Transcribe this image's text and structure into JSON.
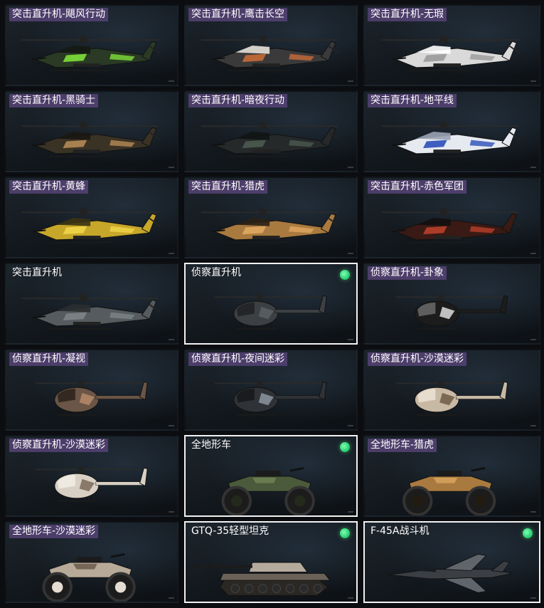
{
  "items": [
    {
      "name": "突击直升机-飓风行动",
      "type": "attack-heli",
      "camo": [
        "#2a3a24",
        "#7ee03a",
        "#151a12"
      ],
      "badge": "tagged",
      "selected": false
    },
    {
      "name": "突击直升机-鹰击长空",
      "type": "attack-heli",
      "camo": [
        "#3a3a3a",
        "#c86c3a",
        "#e8e2da"
      ],
      "badge": "tagged",
      "selected": false
    },
    {
      "name": "突击直升机-无瑕",
      "type": "attack-heli",
      "camo": [
        "#d9d9d9",
        "#9a9a9a",
        "#ffffff"
      ],
      "badge": "tagged",
      "selected": false
    },
    {
      "name": "突击直升机-黑骑士",
      "type": "attack-heli",
      "camo": [
        "#3a3225",
        "#b58a55",
        "#1b1712"
      ],
      "badge": "tagged",
      "selected": false
    },
    {
      "name": "突击直升机-暗夜行动",
      "type": "attack-heli",
      "camo": [
        "#25292a",
        "#4c5a4f",
        "#111414"
      ],
      "badge": "tagged",
      "selected": false
    },
    {
      "name": "突击直升机-地平线",
      "type": "attack-heli",
      "camo": [
        "#e6eaf0",
        "#2a4fb8",
        "#9aa3b4"
      ],
      "badge": "tagged",
      "selected": false
    },
    {
      "name": "突击直升机-黄蜂",
      "type": "attack-heli",
      "camo": [
        "#c7a72a",
        "#f0d64a",
        "#3b3414"
      ],
      "badge": "tagged",
      "selected": false
    },
    {
      "name": "突击直升机-猎虎",
      "type": "attack-heli",
      "camo": [
        "#a97a3f",
        "#e0a862",
        "#2b2116"
      ],
      "badge": "tagged",
      "selected": false
    },
    {
      "name": "突击直升机-赤色军团",
      "type": "attack-heli",
      "camo": [
        "#3a1a14",
        "#b8402a",
        "#141010"
      ],
      "badge": "tagged",
      "selected": false
    },
    {
      "name": "突击直升机",
      "type": "attack-heli",
      "camo": [
        "#555b5e",
        "#7d8488",
        "#2b2f31"
      ],
      "badge": "plain",
      "selected": false
    },
    {
      "name": "侦察直升机",
      "type": "scout-heli",
      "camo": [
        "#3c4043",
        "#5a6064",
        "#1e2123"
      ],
      "badge": "plain",
      "selected": true
    },
    {
      "name": "侦察直升机-卦象",
      "type": "scout-heli",
      "camo": [
        "#1c1c1c",
        "#dcdcdc",
        "#6a6a6a"
      ],
      "badge": "tagged",
      "selected": false
    },
    {
      "name": "侦察直升机-凝视",
      "type": "scout-heli",
      "camo": [
        "#6a5546",
        "#b68a6a",
        "#2a221b"
      ],
      "badge": "tagged",
      "selected": false
    },
    {
      "name": "侦察直升机-夜间迷彩",
      "type": "scout-heli",
      "camo": [
        "#2f3236",
        "#8c95a0",
        "#15171a"
      ],
      "badge": "tagged",
      "selected": false
    },
    {
      "name": "侦察直升机-沙漠迷彩",
      "type": "scout-heli",
      "camo": [
        "#c8b9a4",
        "#6e5a46",
        "#ece3d6"
      ],
      "badge": "tagged",
      "selected": false
    },
    {
      "name": "侦察直升机-沙漠迷彩",
      "type": "scout-heli",
      "camo": [
        "#d8d0c4",
        "#7a6a58",
        "#f2ede6"
      ],
      "badge": "tagged",
      "selected": false
    },
    {
      "name": "全地形车",
      "type": "atv",
      "camo": [
        "#4b5a3a",
        "#6f8256",
        "#232a1b"
      ],
      "badge": "plain",
      "selected": true
    },
    {
      "name": "全地形车-猎虎",
      "type": "atv",
      "camo": [
        "#a97a3f",
        "#d8a55e",
        "#231a10"
      ],
      "badge": "tagged",
      "selected": false
    },
    {
      "name": "全地形车-沙漠迷彩",
      "type": "atv",
      "camo": [
        "#b7aa98",
        "#6b5c4b",
        "#e5ddd2"
      ],
      "badge": "tagged",
      "selected": false
    },
    {
      "name": "GTQ-35轻型坦克",
      "type": "tank",
      "camo": [
        "#6a6258",
        "#b5ab9c",
        "#2b2824"
      ],
      "badge": "plain",
      "selected": true
    },
    {
      "name": "F-45A战斗机",
      "type": "jet",
      "camo": [
        "#3b3f44",
        "#5f656b",
        "#1a1c1f"
      ],
      "badge": "plain",
      "selected": true
    }
  ],
  "icons": {
    "selected_indicator": "green-dot-icon"
  }
}
